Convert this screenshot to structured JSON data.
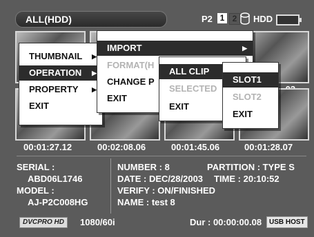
{
  "header": {
    "title": "ALL(HDD)",
    "p2_label": "P2",
    "slot1": "1",
    "slot2": "2",
    "hdd_label": "HDD"
  },
  "thumbnails": [
    {
      "timecode": "00:01:27.12"
    },
    {
      "timecode": "00:02:08.06"
    },
    {
      "timecode": "00:01:45.06"
    },
    {
      "timecode": "00:01:28.07"
    }
  ],
  "partial_timecode": ".03",
  "info": {
    "serial_label": "SERIAL :",
    "serial_value": "ABD06L1746",
    "model_label": "MODEL :",
    "model_value": "AJ-P2C008HG",
    "number": "NUMBER : 8",
    "partition": "PARTITION : TYPE S",
    "date": "DATE : DEC/28/2003",
    "time": "TIME : 20:10:52",
    "verify": "VERIFY : ON/FINISHED",
    "name": "NAME : test 8"
  },
  "footer": {
    "codec": "DVCPRO HD",
    "format": "1080/60i",
    "duration": "Dur : 00:00:00.08",
    "usb": "USB HOST"
  },
  "menus": {
    "main": [
      {
        "label": "THUMBNAIL",
        "arrow": "▶"
      },
      {
        "label": "OPERATION",
        "arrow": "▶"
      },
      {
        "label": "PROPERTY",
        "arrow": "▶"
      },
      {
        "label": "EXIT"
      }
    ],
    "operation": [
      {
        "label": "IMPORT",
        "arrow": "▶"
      },
      {
        "label": "FORMAT(H"
      },
      {
        "label": "CHANGE P"
      },
      {
        "label": "EXIT"
      }
    ],
    "import": [
      {
        "label": "ALL CLIP",
        "arrow": "▶"
      },
      {
        "label": "SELECTED"
      },
      {
        "label": "EXIT"
      }
    ],
    "slot": [
      {
        "label": "SLOT1"
      },
      {
        "label": "SLOT2"
      },
      {
        "label": "EXIT"
      }
    ]
  }
}
